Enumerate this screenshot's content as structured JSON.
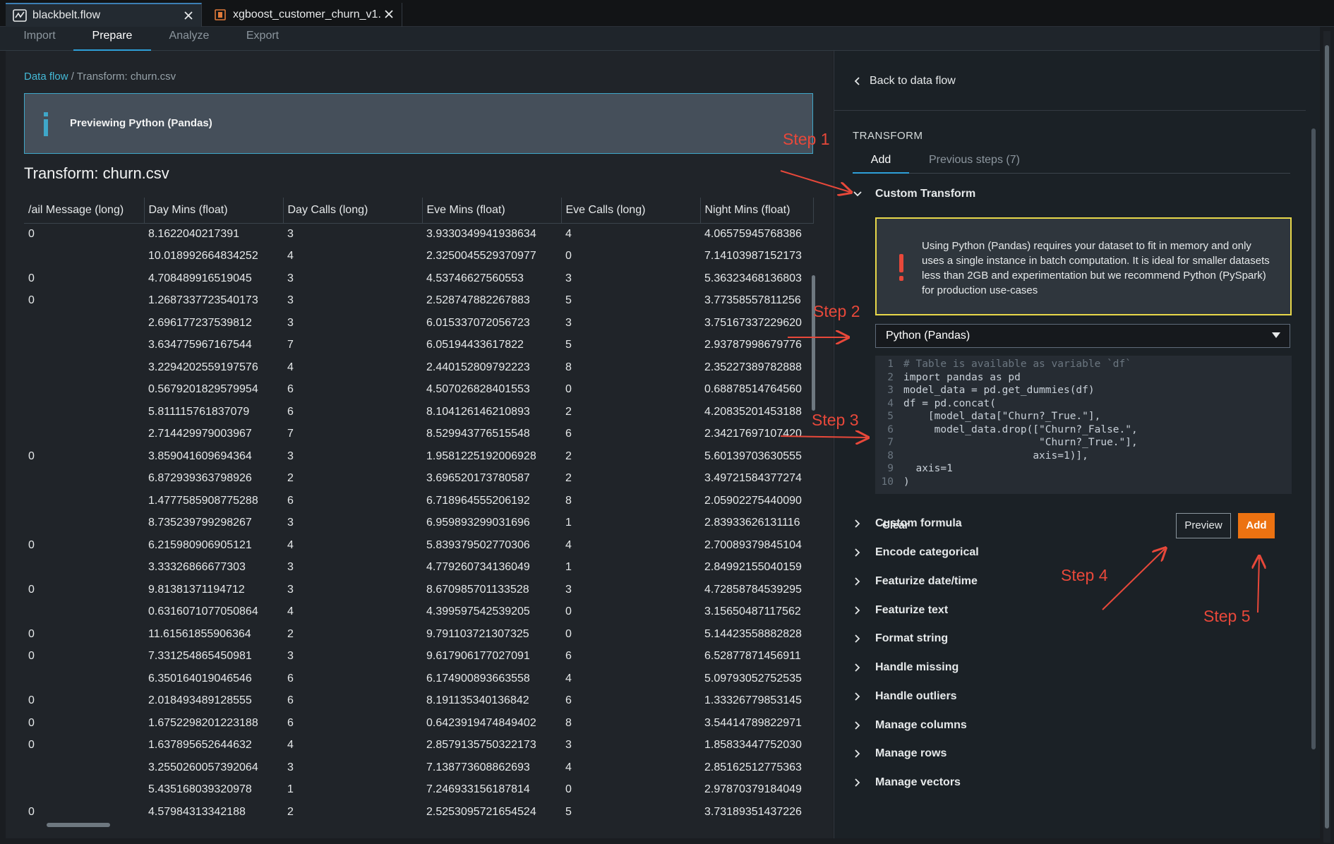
{
  "tabs": [
    {
      "label": "blackbelt.flow"
    },
    {
      "label": "xgboost_customer_churn_v1."
    }
  ],
  "nav": {
    "import": "Import",
    "prepare": "Prepare",
    "analyze": "Analyze",
    "export": "Export"
  },
  "breadcrumb": {
    "link": "Data flow",
    "separator": " / ",
    "current": "Transform: churn.csv"
  },
  "info": {
    "text": "Previewing Python (Pandas)"
  },
  "page_title": "Transform: churn.csv",
  "table": {
    "columns": [
      "/ail Message (long)",
      "Day Mins (float)",
      "Day Calls (long)",
      "Eve Mins (float)",
      "Eve Calls (long)",
      "Night Mins (float)"
    ],
    "rows": [
      [
        "0",
        "8.1622040217391",
        "3",
        "3.9330349941938634",
        "4",
        "4.06575945768386"
      ],
      [
        "",
        "10.018992664834252",
        "4",
        "2.3250045529370977",
        "0",
        "7.14103987152173"
      ],
      [
        "0",
        "4.708489916519045",
        "3",
        "4.53746627560553",
        "3",
        "5.36323468136803"
      ],
      [
        "0",
        "1.2687337723540173",
        "3",
        "2.528747882267883",
        "5",
        "3.77358557811256"
      ],
      [
        "",
        "2.696177237539812",
        "3",
        "6.015337072056723",
        "3",
        "3.75167337229620"
      ],
      [
        "",
        "3.634775967167544",
        "7",
        "6.05194433617822",
        "5",
        "2.93787998679776"
      ],
      [
        "",
        "3.2294202559197576",
        "4",
        "2.440152809792223",
        "8",
        "2.35227389782888"
      ],
      [
        "",
        "0.5679201829579954",
        "6",
        "4.507026828401553",
        "0",
        "0.68878514764560"
      ],
      [
        "",
        "5.811115761837079",
        "6",
        "8.104126146210893",
        "2",
        "4.20835201453188"
      ],
      [
        "",
        "2.714429979003967",
        "7",
        "8.529943776515548",
        "6",
        "2.34217697107420"
      ],
      [
        "0",
        "3.859041609694364",
        "3",
        "1.9581225192006928",
        "2",
        "5.60139703630555"
      ],
      [
        "",
        "6.872939363798926",
        "2",
        "3.696520173780587",
        "2",
        "3.49721584377274"
      ],
      [
        "",
        "1.4777585908775288",
        "6",
        "6.718964555206192",
        "8",
        "2.05902275440090"
      ],
      [
        "",
        "8.735239799298267",
        "3",
        "6.959893299031696",
        "1",
        "2.83933626131116"
      ],
      [
        "0",
        "6.215980906905121",
        "4",
        "5.839379502770306",
        "4",
        "2.70089379845104"
      ],
      [
        "",
        "3.33326866677303",
        "3",
        "4.779260734136049",
        "1",
        "2.84992155040159"
      ],
      [
        "0",
        "9.81381371194712",
        "3",
        "8.670985701133528",
        "3",
        "4.72858784539295"
      ],
      [
        "",
        "0.6316071077050864",
        "4",
        "4.399597542539205",
        "0",
        "3.15650487117562"
      ],
      [
        "0",
        "11.61561855906364",
        "2",
        "9.791103721307325",
        "0",
        "5.14423558882828"
      ],
      [
        "0",
        "7.331254865450981",
        "3",
        "9.617906177027091",
        "6",
        "6.52877871456911"
      ],
      [
        "",
        "6.350164019046546",
        "6",
        "6.174900893663558",
        "4",
        "5.09793052752535"
      ],
      [
        "0",
        "2.018493489128555",
        "6",
        "8.191135340136842",
        "6",
        "1.33326779853145"
      ],
      [
        "0",
        "1.6752298201223188",
        "6",
        "0.6423919474849402",
        "8",
        "3.54414789822971"
      ],
      [
        "0",
        "1.637895652644632",
        "4",
        "2.8579135750322173",
        "3",
        "1.85833447752030"
      ],
      [
        "",
        "3.2550260057392064",
        "3",
        "7.138773608862693",
        "4",
        "2.85162512775363"
      ],
      [
        "",
        "5.435168039320978",
        "1",
        "7.246933156187814",
        "0",
        "2.97870379184049"
      ],
      [
        "0",
        "4.57984313342188",
        "2",
        "2.5253095721654524",
        "5",
        "3.73189351437226"
      ]
    ]
  },
  "right": {
    "back": "Back to data flow",
    "transform_header": "TRANSFORM",
    "subtabs": {
      "add": "Add",
      "previous": "Previous steps (7)"
    },
    "custom_transform": "Custom Transform",
    "warning": "Using Python (Pandas) requires your dataset to fit in memory and only uses a single instance in batch computation. It is ideal for smaller datasets less than 2GB and experimentation but we recommend Python (PySpark) for production use-cases",
    "select_value": "Python (Pandas)",
    "clear": "Clear",
    "preview": "Preview",
    "add": "Add",
    "sections": [
      "Custom formula",
      "Encode categorical",
      "Featurize date/time",
      "Featurize text",
      "Format string",
      "Handle missing",
      "Handle outliers",
      "Manage columns",
      "Manage rows",
      "Manage vectors"
    ]
  },
  "code": [
    {
      "n": "1",
      "t": "# Table is available as variable `df`"
    },
    {
      "n": "2",
      "t": "import pandas as pd"
    },
    {
      "n": "3",
      "t": "model_data = pd.get_dummies(df)"
    },
    {
      "n": "4",
      "t": "df = pd.concat("
    },
    {
      "n": "5",
      "t": "    [model_data[\"Churn?_True.\"],"
    },
    {
      "n": "6",
      "t": "     model_data.drop([\"Churn?_False.\","
    },
    {
      "n": "7",
      "t": "                      \"Churn?_True.\"],"
    },
    {
      "n": "8",
      "t": "                     axis=1)],"
    },
    {
      "n": "9",
      "t": "  axis=1"
    },
    {
      "n": "10",
      "t": ")"
    }
  ],
  "steps": [
    "Step 1",
    "Step 2",
    "Step 3",
    "Step 4",
    "Step 5"
  ],
  "colors": {
    "accent_blue": "#2e9fd8",
    "link": "#44b9d6",
    "add_button": "#ec7211",
    "warning_border": "#e8d84a",
    "step_red": "#e8483a"
  },
  "icons": [
    "flow-icon",
    "notebook-icon",
    "close-icon",
    "info-icon",
    "chevron-left-icon",
    "chevron-down-icon",
    "chevron-right-icon",
    "alert-icon",
    "caret-down-icon"
  ]
}
